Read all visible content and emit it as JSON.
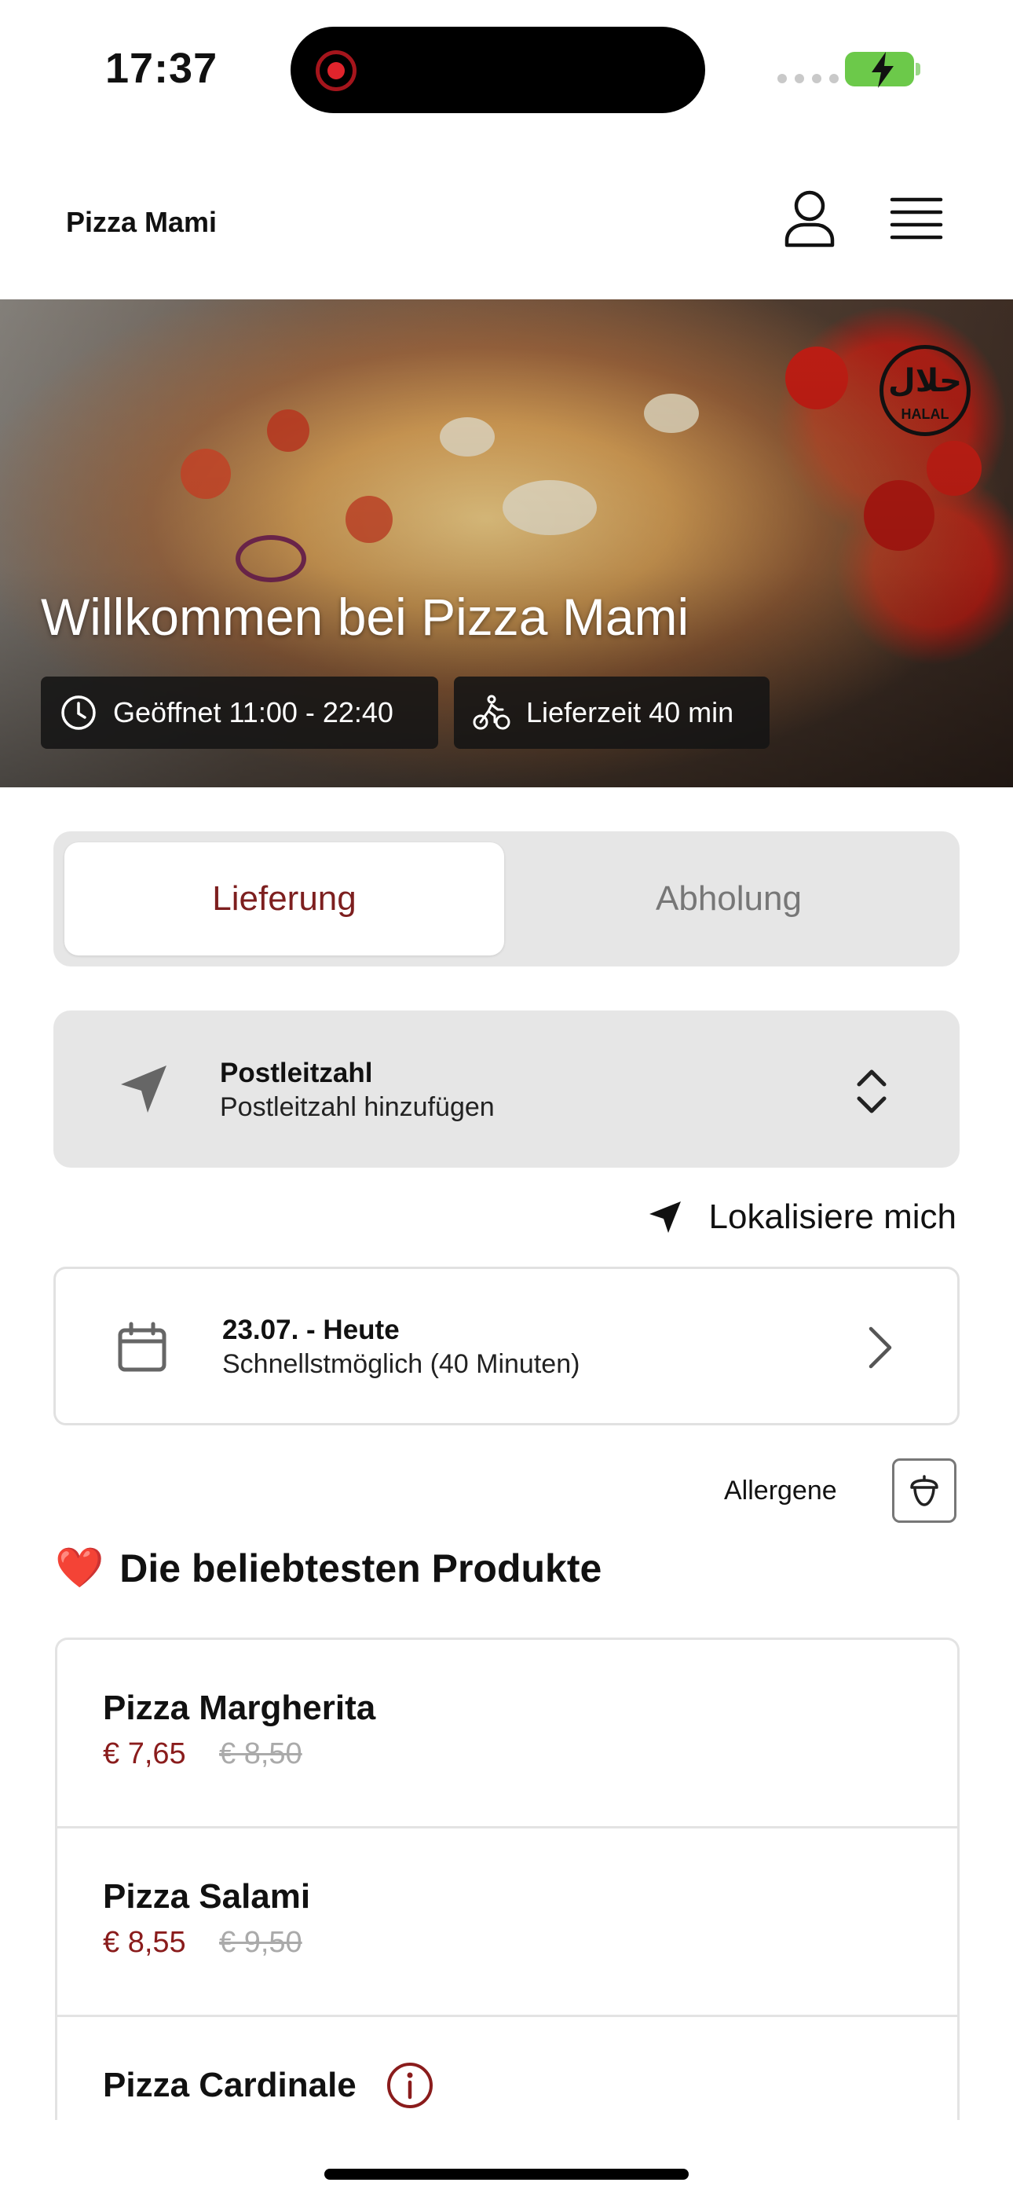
{
  "status_bar": {
    "time": "17:37"
  },
  "header": {
    "brand": "Pizza Mami",
    "user_icon": "user-icon",
    "menu_icon": "hamburger-menu-icon"
  },
  "hero": {
    "title": "Willkommen bei Pizza Mami",
    "badge_text": "HALAL",
    "badge_arabic": "حلال",
    "open_hours": "Geöffnet 11:00 - 22:40",
    "delivery_time": "Lieferzeit 40 min"
  },
  "order_mode": {
    "options": [
      "Lieferung",
      "Abholung"
    ],
    "selected": "Lieferung"
  },
  "postcode": {
    "label": "Postleitzahl",
    "placeholder": "Postleitzahl hinzufügen"
  },
  "locate": {
    "label": "Lokalisiere mich"
  },
  "schedule": {
    "date": "23.07. - Heute",
    "time": "Schnellstmöglich (40 Minuten)"
  },
  "allergens": {
    "label": "Allergene"
  },
  "popular": {
    "emoji": "❤️",
    "title": "Die beliebtesten Produkte",
    "products": [
      {
        "name": "Pizza Margherita",
        "price": "€ 7,65",
        "old_price": "€ 8,50"
      },
      {
        "name": "Pizza Salami",
        "price": "€ 8,55",
        "old_price": "€ 9,50"
      },
      {
        "name": "Pizza Cardinale",
        "price": "",
        "old_price": ""
      }
    ]
  },
  "colors": {
    "accent": "#7d1f1f",
    "price": "#8a1c1c",
    "panel": "#e6e6e6"
  }
}
